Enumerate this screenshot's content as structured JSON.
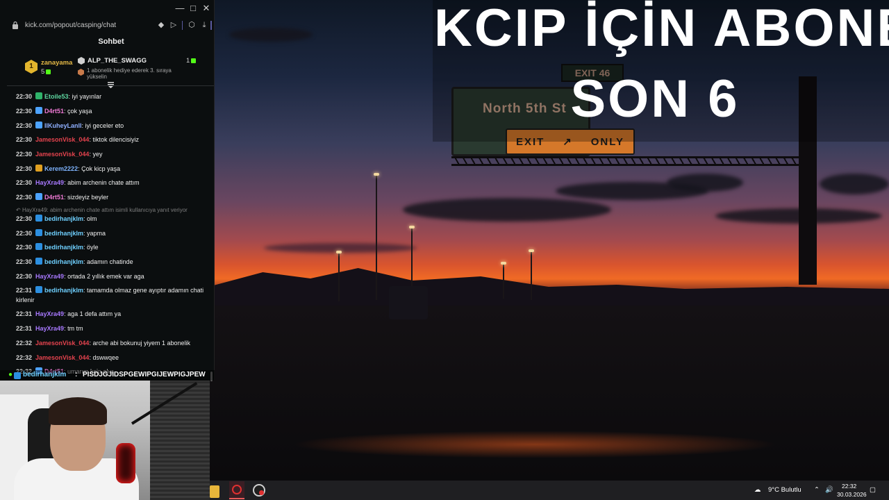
{
  "browser": {
    "url": "kick.com/popout/casping/chat"
  },
  "chat": {
    "title": "Sohbet",
    "pinned": {
      "gifter": {
        "rank": "1",
        "name": "zanayama",
        "count": "5"
      },
      "recipient": {
        "name": "ALP_THE_SWAGG",
        "count": "1",
        "note": "1 abonelik hediye ederek 3. sıraya yükselin"
      }
    },
    "messages": [
      {
        "time": "22:30",
        "user": "Etoile53",
        "color": "#5ed6a0",
        "badge": "#2fb36a",
        "text": ": iyi yayınlar"
      },
      {
        "time": "22:30",
        "user": "D4rt51",
        "color": "#f07ad6",
        "badge": "#4da3ff",
        "text": ": çok yaşa"
      },
      {
        "time": "22:30",
        "user": "IlKuheyLanll",
        "color": "#8fb0ff",
        "badge": "#4da3ff",
        "text": ": iyi geceler eto"
      },
      {
        "time": "22:30",
        "user": "JamesonVisk_044",
        "color": "#e4434e",
        "badge": "",
        "text": ": tiktok dilencisiyiz"
      },
      {
        "time": "22:30",
        "user": "JamesonVisk_044",
        "color": "#e4434e",
        "badge": "",
        "text": ": yey"
      },
      {
        "time": "22:30",
        "user": "Kerem2222",
        "color": "#7fb4ff",
        "badge": "#e0a020",
        "text": ": Çok kicp yaşa"
      },
      {
        "time": "22:30",
        "user": "HayXra49",
        "color": "#a879ff",
        "badge": "",
        "text": ": abim archenin chate attım"
      },
      {
        "time": "22:30",
        "user": "D4rt51",
        "color": "#f07ad6",
        "badge": "#4da3ff",
        "text": ": sizdeyiz beyler"
      },
      {
        "time": "22:30",
        "user": "bedirhanjklm",
        "color": "#6fd0ff",
        "badge": "#2c8fe0",
        "text": ": olm"
      },
      {
        "time": "22:30",
        "user": "bedirhanjklm",
        "color": "#6fd0ff",
        "badge": "#2c8fe0",
        "text": ": yapma"
      },
      {
        "time": "22:30",
        "user": "bedirhanjklm",
        "color": "#6fd0ff",
        "badge": "#2c8fe0",
        "text": ": öyle"
      },
      {
        "time": "22:30",
        "user": "bedirhanjklm",
        "color": "#6fd0ff",
        "badge": "#2c8fe0",
        "text": ": adamın chatinde"
      },
      {
        "time": "22:30",
        "user": "HayXra49",
        "color": "#a879ff",
        "badge": "",
        "text": ": ortada 2 yıllık emek var aga"
      },
      {
        "time": "22:31",
        "user": "bedirhanjklm",
        "color": "#6fd0ff",
        "badge": "#2c8fe0",
        "text": ": tamamda olmaz gene ayıptır adamın chati kirlenir"
      },
      {
        "time": "22:31",
        "user": "HayXra49",
        "color": "#a879ff",
        "badge": "",
        "text": ": aga 1 defa attım ya"
      },
      {
        "time": "22:31",
        "user": "HayXra49",
        "color": "#a879ff",
        "badge": "",
        "text": ": tm tm"
      },
      {
        "time": "22:32",
        "user": "JamesonVisk_044",
        "color": "#e4434e",
        "badge": "",
        "text": ": arche abi bokunuj yiyem 1 abonelik"
      },
      {
        "time": "22:32",
        "user": "JamesonVisk_044",
        "color": "#e4434e",
        "badge": "",
        "text": ": dswwqee"
      },
      {
        "time": "22:32",
        "user": "D4rt51",
        "color": "#f07ad6",
        "badge": "#4da3ff",
        "text": ": umarım kcip olur"
      }
    ],
    "reply_note": "HayXra49: abim archenin chate attım isimli kullanıcıya yanıt veriyor",
    "ticker": {
      "user": "bedirhanjklm",
      "text": "PISDJGJIDSPGEWIPGIJEWPIGJPEW"
    }
  },
  "overlay": {
    "line1": "KCIP İÇİN ABONE",
    "line2": "SON 6"
  },
  "scene_signs": {
    "exit46": "EXIT 46",
    "north": "North 5th St",
    "exit_only_left": "EXIT",
    "exit_only_right": "ONLY"
  },
  "taskbar": {
    "weather": "9°C  Bulutlu",
    "time": "22:32",
    "date": "30.03.2026"
  }
}
